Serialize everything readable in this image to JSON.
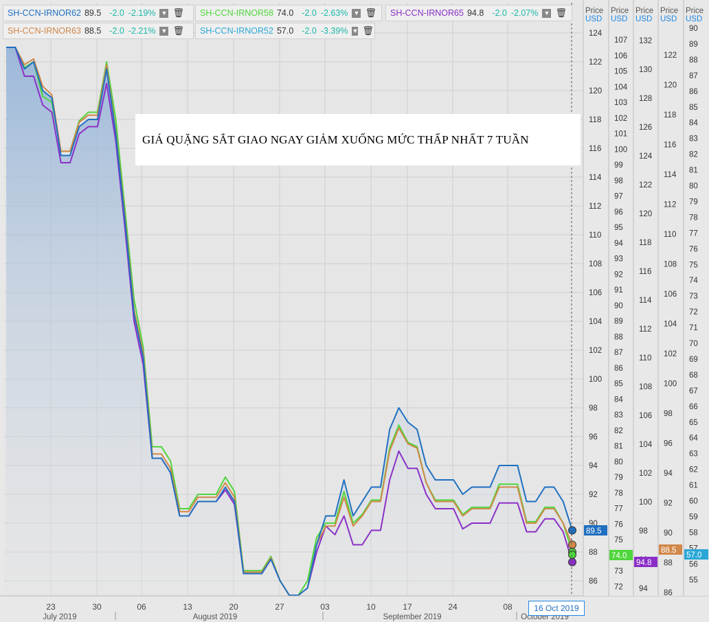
{
  "legend": [
    {
      "name": "SH-CCN-IRNOR62",
      "value": "89.5",
      "change": "-2.0",
      "pct": "-2.19%",
      "color": "#1f6fc0"
    },
    {
      "name": "SH-CCN-IRNOR58",
      "value": "74.0",
      "change": "-2.0",
      "pct": "-2.63%",
      "color": "#4fd63c"
    },
    {
      "name": "SH-CCN-IRNOR65",
      "value": "94.8",
      "change": "-2.0",
      "pct": "-2.07%",
      "color": "#8a2fc6"
    },
    {
      "name": "SH-CCN-IRNOR63",
      "value": "88.5",
      "change": "-2.0",
      "pct": "-2.21%",
      "color": "#d1884a"
    },
    {
      "name": "SH-CCN-IRNOR52",
      "value": "57.0",
      "change": "-2.0",
      "pct": "-3.39%",
      "color": "#2aa7d6"
    }
  ],
  "title": "GIÁ QUẶNG SẮT GIAO NGAY GIẢM XUỐNG MỨC THẤP NHẤT 7 TUẦN",
  "date_tag": "16 Oct 2019",
  "chart_data": {
    "type": "line",
    "x_tick_labels": [
      "23",
      "30",
      "06",
      "13",
      "20",
      "27",
      "03",
      "10",
      "17",
      "24",
      "08"
    ],
    "x_month_labels": [
      "July 2019",
      "August 2019",
      "September 2019",
      "October 2019"
    ],
    "axis_header": {
      "top": "Price",
      "bottom": "USD"
    },
    "axes": [
      {
        "series": "SH-CCN-IRNOR62",
        "ticks": [
          86,
          88,
          90,
          92,
          94,
          96,
          98,
          100,
          102,
          104,
          106,
          108,
          110,
          112,
          114,
          116,
          118,
          120,
          122,
          124
        ],
        "last": "89.5",
        "color": "#1f6fc0"
      },
      {
        "series": "SH-CCN-IRNOR58",
        "ticks": [
          72,
          73,
          75,
          76,
          77,
          78,
          79,
          80,
          81,
          82,
          83,
          84,
          85,
          86,
          87,
          88,
          89,
          90,
          91,
          92,
          93,
          94,
          95,
          96,
          97,
          98,
          99,
          100,
          101,
          102,
          103,
          104,
          105,
          106,
          107
        ],
        "last": "74.0",
        "color": "#4fd63c"
      },
      {
        "series": "SH-CCN-IRNOR65",
        "ticks": [
          94,
          96,
          98,
          100,
          102,
          104,
          106,
          108,
          110,
          112,
          114,
          116,
          118,
          120,
          122,
          124,
          126,
          128,
          130,
          132
        ],
        "last": "94.8",
        "color": "#8a2fc6"
      },
      {
        "series": "SH-CCN-IRNOR63",
        "ticks": [
          86,
          88,
          90,
          92,
          94,
          96,
          98,
          100,
          102,
          104,
          106,
          108,
          110,
          112,
          114,
          116,
          118,
          120,
          122
        ],
        "last": "88.5",
        "color": "#d1884a"
      },
      {
        "series": "SH-CCN-IRNOR52",
        "ticks": [
          55,
          56,
          57,
          58,
          59,
          60,
          61,
          62,
          63,
          64,
          65,
          66,
          67,
          68,
          69,
          70,
          71,
          72,
          73,
          74,
          75,
          76,
          77,
          78,
          79,
          80,
          81,
          82,
          83,
          84,
          85,
          86,
          87,
          88,
          89,
          90
        ],
        "last": "57.0",
        "color": "#2aa7d6"
      }
    ],
    "series": [
      {
        "name": "SH-CCN-IRNOR62",
        "color": "#1f6fc0",
        "values": [
          123.0,
          123.0,
          121.5,
          122.0,
          120.0,
          119.5,
          115.5,
          115.5,
          117.5,
          118.0,
          118.0,
          121.5,
          117.0,
          111.0,
          104.5,
          101.5,
          94.5,
          94.5,
          93.5,
          90.5,
          90.5,
          91.5,
          91.5,
          91.5,
          92.5,
          91.5,
          86.5,
          86.5,
          86.5,
          87.5,
          86.0,
          85.0,
          85.0,
          85.5,
          88.5,
          90.5,
          90.5,
          93.0,
          90.5,
          91.5,
          92.5,
          92.5,
          96.5,
          98.0,
          97.0,
          96.5,
          94.0,
          93.0,
          93.0,
          93.0,
          92.0,
          92.5,
          92.5,
          92.5,
          94.0,
          94.0,
          94.0,
          91.5,
          91.5,
          92.5,
          92.5,
          91.5,
          89.5
        ]
      },
      {
        "name": "SH-CCN-IRNOR63",
        "values": [
          123.0,
          123.0,
          121.8,
          122.2,
          120.3,
          119.7,
          115.8,
          115.8,
          117.8,
          118.3,
          118.3,
          121.8,
          117.2,
          111.3,
          104.8,
          101.8,
          94.8,
          94.8,
          93.8,
          90.8,
          90.8,
          91.8,
          91.8,
          91.8,
          92.8,
          91.8,
          86.6,
          86.6,
          86.6,
          87.6,
          86.0,
          85.0,
          85.0,
          85.5,
          88.5,
          89.8,
          89.8,
          91.8,
          89.8,
          90.5,
          91.5,
          91.5,
          95.0,
          96.6,
          95.5,
          95.2,
          92.8,
          91.5,
          91.5,
          91.5,
          90.5,
          91.0,
          91.0,
          91.0,
          92.5,
          92.5,
          92.5,
          90.0,
          90.0,
          91.0,
          91.0,
          90.0,
          88.5
        ]
      },
      {
        "name": "SH-CCN-IRNOR58",
        "values": [
          123.0,
          123.0,
          121.6,
          122.0,
          119.6,
          119.2,
          115.8,
          115.8,
          117.9,
          118.5,
          118.5,
          122.0,
          118.0,
          111.8,
          105.5,
          102.2,
          95.3,
          95.3,
          94.3,
          91.0,
          91.0,
          92.0,
          92.0,
          92.0,
          93.2,
          92.2,
          86.7,
          86.7,
          86.7,
          87.7,
          86.0,
          85.0,
          85.0,
          86.0,
          89.0,
          90.0,
          90.0,
          92.2,
          90.0,
          90.6,
          91.6,
          91.6,
          95.2,
          96.8,
          95.6,
          95.3,
          92.8,
          91.6,
          91.6,
          91.6,
          90.6,
          91.1,
          91.1,
          91.1,
          92.7,
          92.7,
          92.7,
          90.1,
          90.1,
          91.1,
          91.1,
          90.0,
          88.0
        ]
      },
      {
        "name": "SH-CCN-IRNOR65",
        "values": [
          123.0,
          123.0,
          121.0,
          121.0,
          119.0,
          118.5,
          115.0,
          115.0,
          117.0,
          117.5,
          117.5,
          120.5,
          116.5,
          110.5,
          104.0,
          101.0,
          94.5,
          94.5,
          93.5,
          90.5,
          90.5,
          91.5,
          91.5,
          91.5,
          92.3,
          91.3,
          86.5,
          86.5,
          86.5,
          87.5,
          86.0,
          85.0,
          85.0,
          85.5,
          88.0,
          89.8,
          89.2,
          90.5,
          88.5,
          88.5,
          89.5,
          89.5,
          93.0,
          95.0,
          93.8,
          93.8,
          92.0,
          91.0,
          91.0,
          91.0,
          89.6,
          90.0,
          90.0,
          90.0,
          91.4,
          91.4,
          91.4,
          89.4,
          89.4,
          90.3,
          90.3,
          89.4,
          87.3
        ]
      }
    ]
  }
}
